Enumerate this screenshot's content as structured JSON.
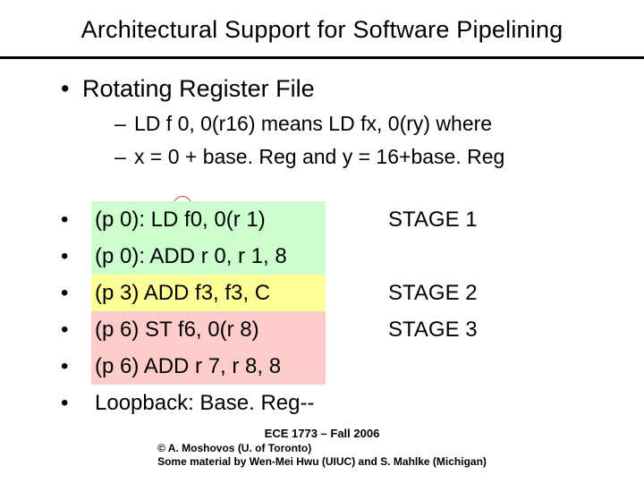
{
  "title": "Architectural Support for Software Pipelining",
  "heading": "Rotating Register File",
  "sub": {
    "a": "LD f 0, 0(r16) means LD fx, 0(ry) where",
    "b": "x = 0 + base. Reg and y = 16+base. Reg"
  },
  "code": {
    "r0": "(p 0): LD f0, 0(r 1)",
    "r1": "(p 0): ADD r 0, r 1, 8",
    "r2": "(p 3) ADD f3, f3, C",
    "r3": "(p 6) ST f6, 0(r 8)",
    "r4": "(p 6) ADD r 7, r 8, 8",
    "r5": "Loopback: Base. Reg--"
  },
  "stage": {
    "s1": "STAGE 1",
    "s2": "STAGE 2",
    "s3": "STAGE 3"
  },
  "footer": {
    "course": "ECE 1773 – Fall 2006",
    "l1": "© A. Moshovos (U. of Toronto)",
    "l2": "Some material by Wen-Mei Hwu (UIUC) and S. Mahlke (Michigan)"
  }
}
